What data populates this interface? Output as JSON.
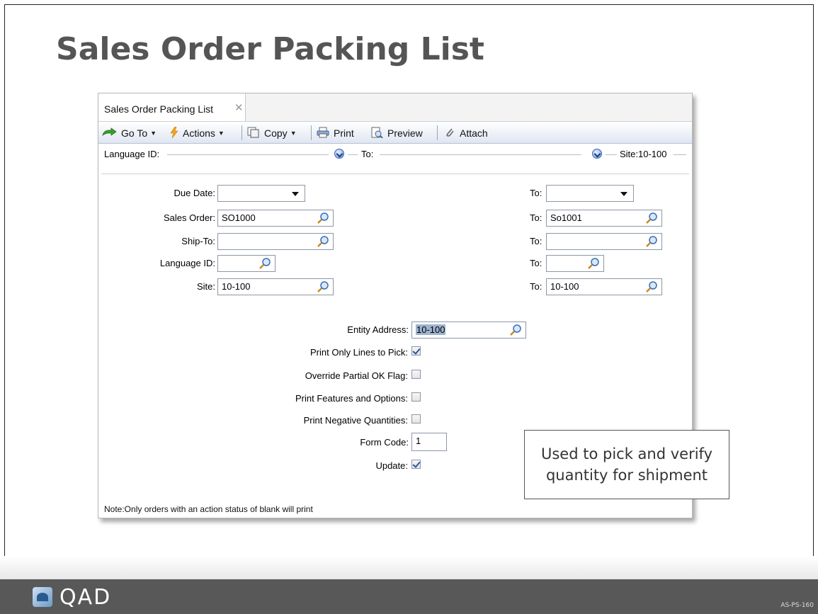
{
  "slide": {
    "title": "Sales Order Packing List",
    "code": "AS-PS-160",
    "logo_text": "QAD"
  },
  "window": {
    "tab_label": "Sales Order Packing List",
    "tab_close_icon": "close-icon"
  },
  "toolbar": {
    "goto_label": "Go To",
    "actions_label": "Actions",
    "copy_label": "Copy",
    "print_label": "Print",
    "preview_label": "Preview",
    "attach_label": "Attach"
  },
  "filter_line": {
    "language_label": "Language ID:",
    "to_label": "To:",
    "site_label": "Site:10-100"
  },
  "form": {
    "due_date": {
      "label": "Due Date:",
      "value": "",
      "to_label": "To:",
      "to_value": ""
    },
    "sales_order": {
      "label": "Sales Order:",
      "value": "SO1000",
      "to_label": "To:",
      "to_value": "So1001"
    },
    "ship_to": {
      "label": "Ship-To:",
      "value": "",
      "to_label": "To:",
      "to_value": ""
    },
    "language_id": {
      "label": "Language ID:",
      "value": "",
      "to_label": "To:",
      "to_value": ""
    },
    "site": {
      "label": "Site:",
      "value": "10-100",
      "to_label": "To:",
      "to_value": "10-100"
    },
    "entity_address": {
      "label": "Entity Address:",
      "value": "10-100"
    },
    "print_only_lines": {
      "label": "Print Only Lines to Pick:",
      "checked": true
    },
    "override_partial": {
      "label": "Override Partial OK Flag:",
      "checked": false
    },
    "print_features": {
      "label": "Print Features and Options:",
      "checked": false
    },
    "print_negative": {
      "label": "Print Negative Quantities:",
      "checked": false
    },
    "form_code": {
      "label": "Form Code:",
      "value": "1"
    },
    "update": {
      "label": "Update:",
      "checked": true
    }
  },
  "note": "Note:Only orders with an action status of blank will print",
  "callout": {
    "line1": "Used to pick and verify",
    "line2": "quantity for shipment"
  }
}
